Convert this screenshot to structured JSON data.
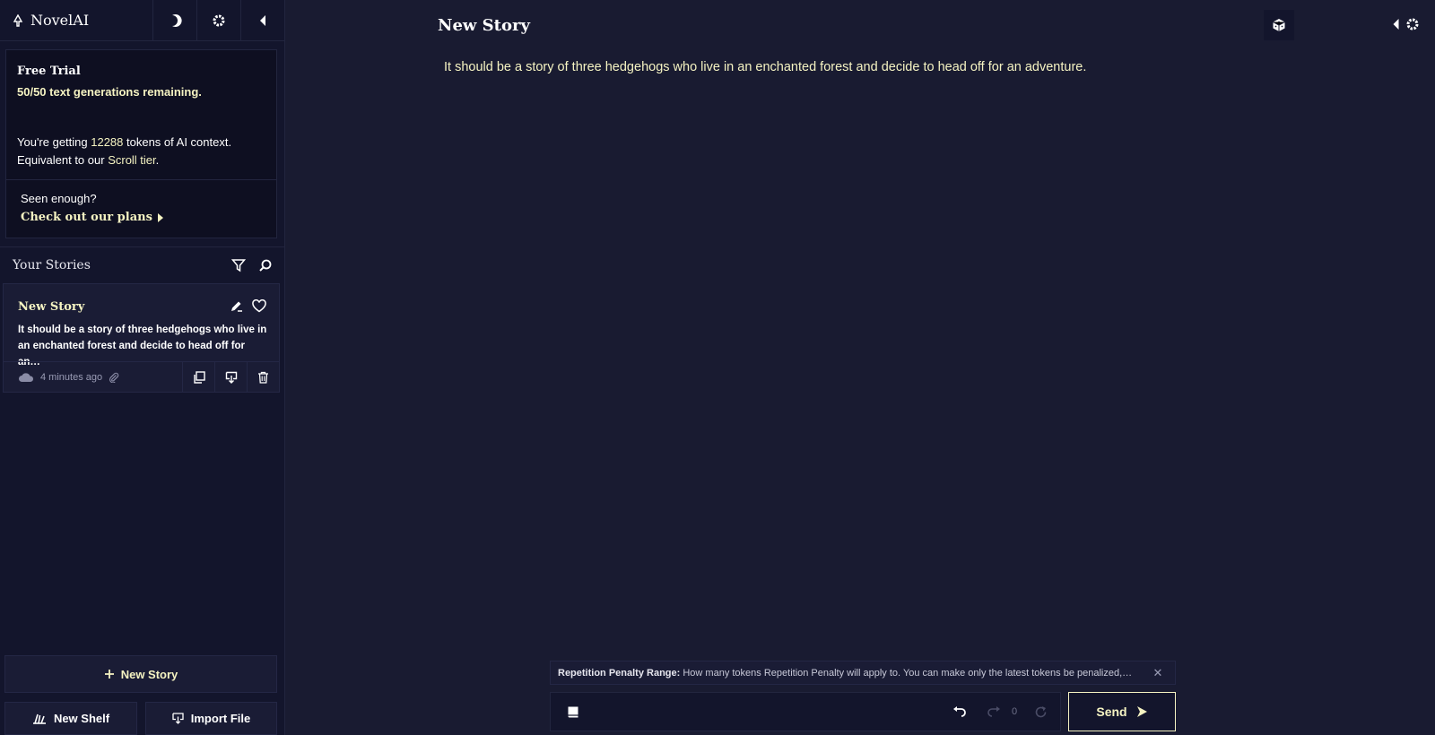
{
  "app": {
    "name": "NovelAI"
  },
  "trial": {
    "title": "Free Trial",
    "remaining": "50/50 text generations remaining.",
    "tokens_prefix": "You're getting ",
    "tokens_value": "12288",
    "tokens_suffix": " tokens of AI context.",
    "equiv_prefix": "Equivalent to our ",
    "equiv_tier": "Scroll tier",
    "equiv_suffix": ".",
    "seen_enough": "Seen enough?",
    "plans_link": "Check out our plans"
  },
  "stories": {
    "header": "Your Stories",
    "items": [
      {
        "title": "New Story",
        "preview": "It should be a story of three hedgehogs who live in an enchanted forest and decide to head off for an…",
        "time": "4 minutes ago"
      }
    ]
  },
  "sidebar_buttons": {
    "new_story": "New Story",
    "new_shelf": "New Shelf",
    "import_file": "Import File"
  },
  "editor": {
    "title": "New Story",
    "text": "It should be a story of three hedgehogs who live in an enchanted forest and decide to head off  for an adventure."
  },
  "tip": {
    "label": "Repetition Penalty Range:",
    "text": " How many tokens Repetition Penalty will apply to. You can make only the latest tokens be penalized,…"
  },
  "input": {
    "redo_count": "0",
    "send_label": "Send"
  },
  "colors": {
    "background": "#191b31",
    "sidebar": "#13152c",
    "accent": "#f5f3c2"
  }
}
